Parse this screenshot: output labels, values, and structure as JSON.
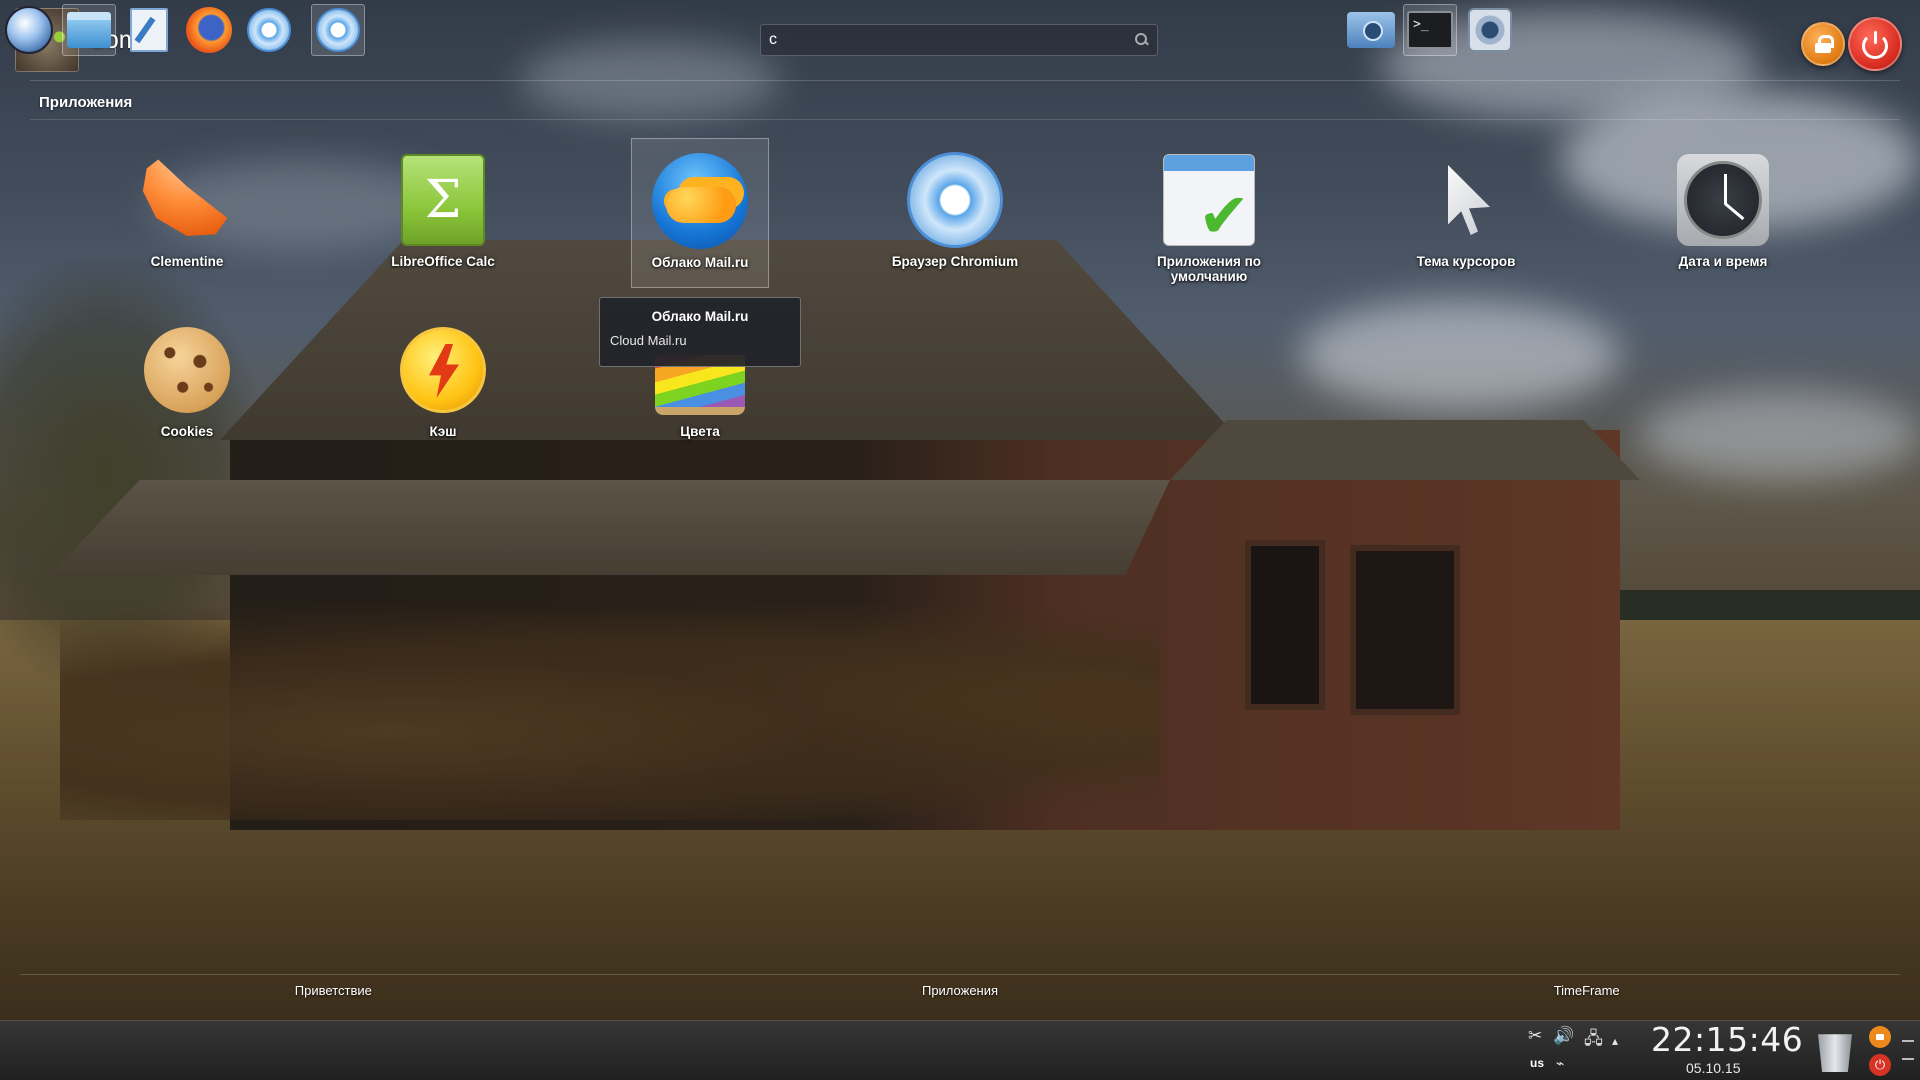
{
  "user": {
    "name": "dom"
  },
  "search": {
    "value": "c",
    "placeholder": ""
  },
  "section": {
    "title": "Приложения"
  },
  "apps": [
    {
      "label": "Clementine",
      "icon": "clementine-icon"
    },
    {
      "label": "LibreOffice Calc",
      "icon": "spreadsheet-icon"
    },
    {
      "label": "Облако Mail.ru",
      "icon": "cloud-mailru-icon"
    },
    {
      "label": "Браузер Chromium",
      "icon": "chromium-icon"
    },
    {
      "label": "Приложения по умолчанию",
      "icon": "default-apps-icon"
    },
    {
      "label": "Тема курсоров",
      "icon": "cursor-theme-icon"
    },
    {
      "label": "Дата и время",
      "icon": "clock-icon"
    },
    {
      "label": "Cookies",
      "icon": "cookie-icon"
    },
    {
      "label": "Кэш",
      "icon": "cache-icon"
    },
    {
      "label": "Цвета",
      "icon": "colors-icon"
    }
  ],
  "tooltip": {
    "title": "Облако Mail.ru",
    "description": "Cloud Mail.ru"
  },
  "tabs": [
    "Приветствие",
    "Приложения",
    "TimeFrame"
  ],
  "taskbar": {
    "keyboard_layout": "us",
    "time": "22:15:46",
    "date": "05.10.15"
  },
  "colors": {
    "lock": "#e07b12",
    "power": "#d62a1e"
  }
}
